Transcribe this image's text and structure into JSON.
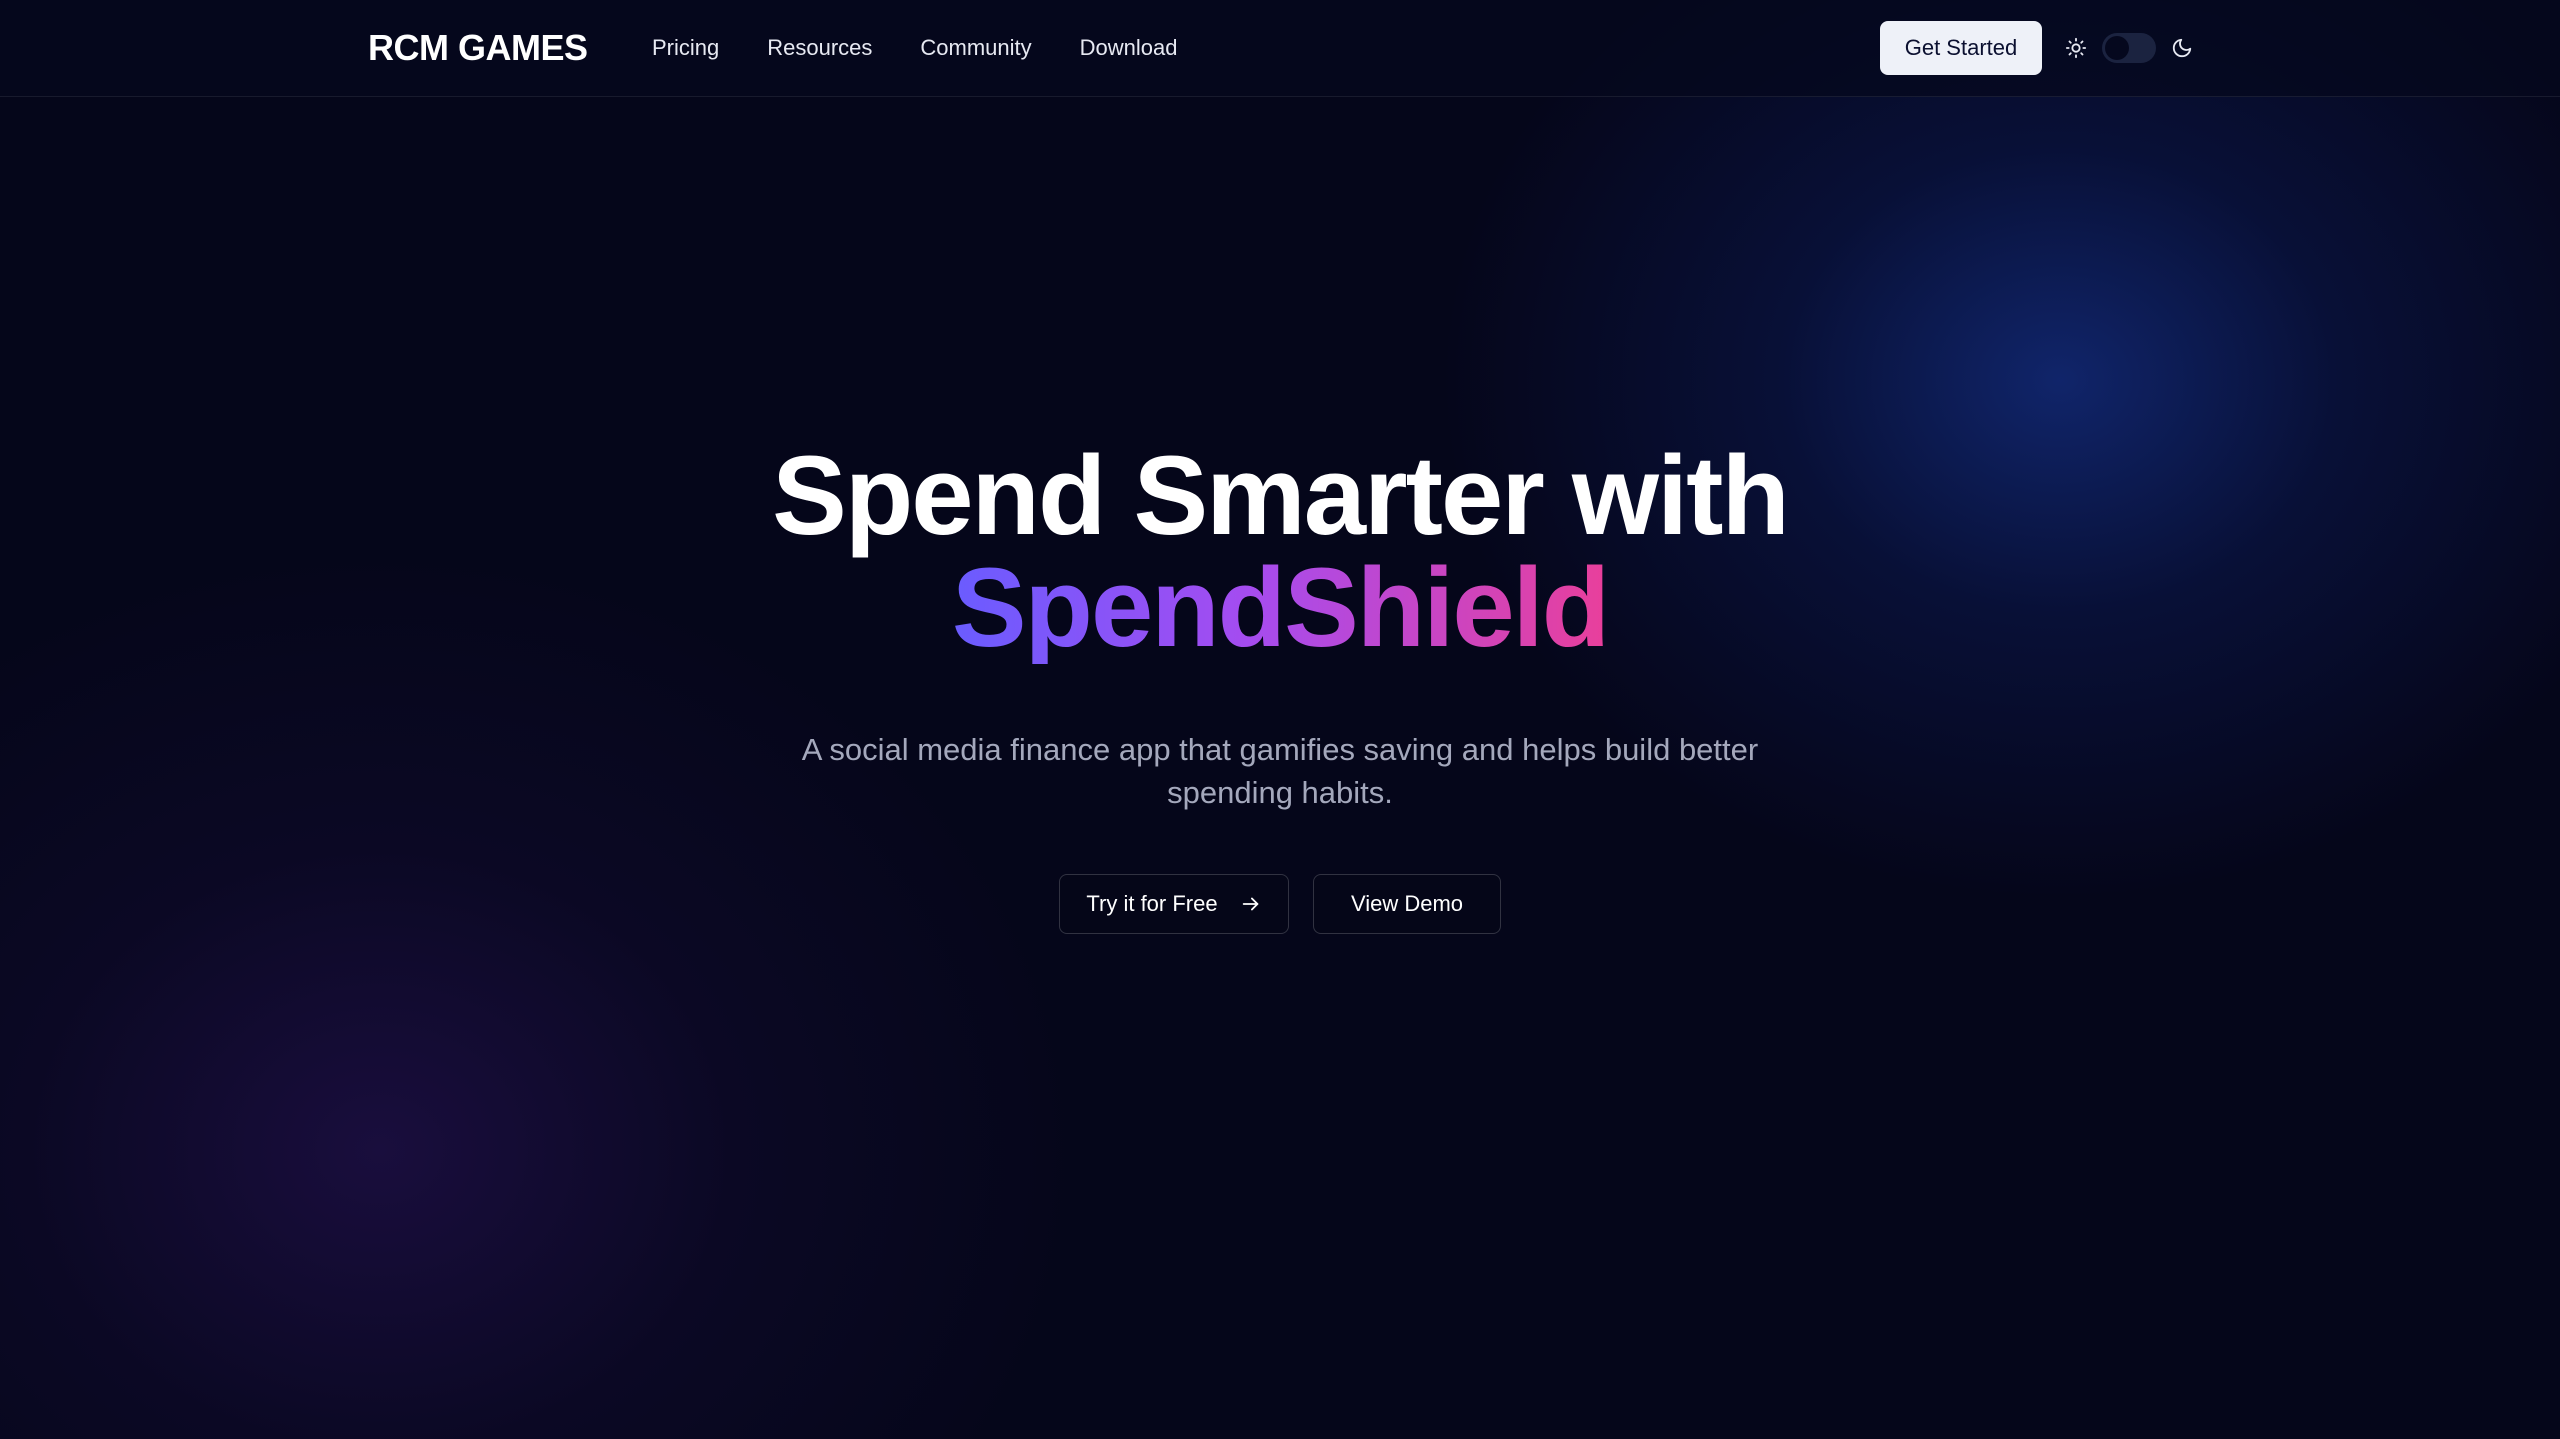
{
  "nav": {
    "brand": "RCM GAMES",
    "links": [
      "Pricing",
      "Resources",
      "Community",
      "Download"
    ],
    "cta": "Get Started",
    "theme_toggle": {
      "mode": "dark",
      "icons": [
        "sun-icon",
        "moon-icon"
      ]
    }
  },
  "hero": {
    "headline_line1": "Spend Smarter with",
    "headline_line2": "SpendShield",
    "subtitle": "A social media finance app that gamifies saving and helps build better spending habits.",
    "primary_cta": "Try it for Free",
    "primary_cta_icon": "arrow-right-icon",
    "secondary_cta": "View Demo"
  },
  "colors": {
    "background": "#05061a",
    "gradient_start": "#6a5cff",
    "gradient_mid": "#a54cf0",
    "gradient_end": "#e93f9b",
    "cta_bg": "#eef1f8"
  }
}
